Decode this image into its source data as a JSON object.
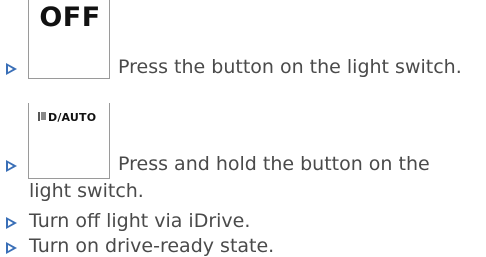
{
  "steps": [
    {
      "button_label": "OFF",
      "text": "Press the button on the light switch."
    },
    {
      "button_label": "D/AUTO",
      "button_icon": "low-beam-headlight-icon",
      "text_line1": "Press and hold the button on the",
      "text_line2": "light switch."
    },
    {
      "text": "Turn off light via iDrive."
    },
    {
      "text": "Turn on drive-ready state."
    }
  ],
  "colors": {
    "bullet": "#3a6fb7",
    "text": "#4a4a4a",
    "button_border": "#9a9a9a"
  }
}
